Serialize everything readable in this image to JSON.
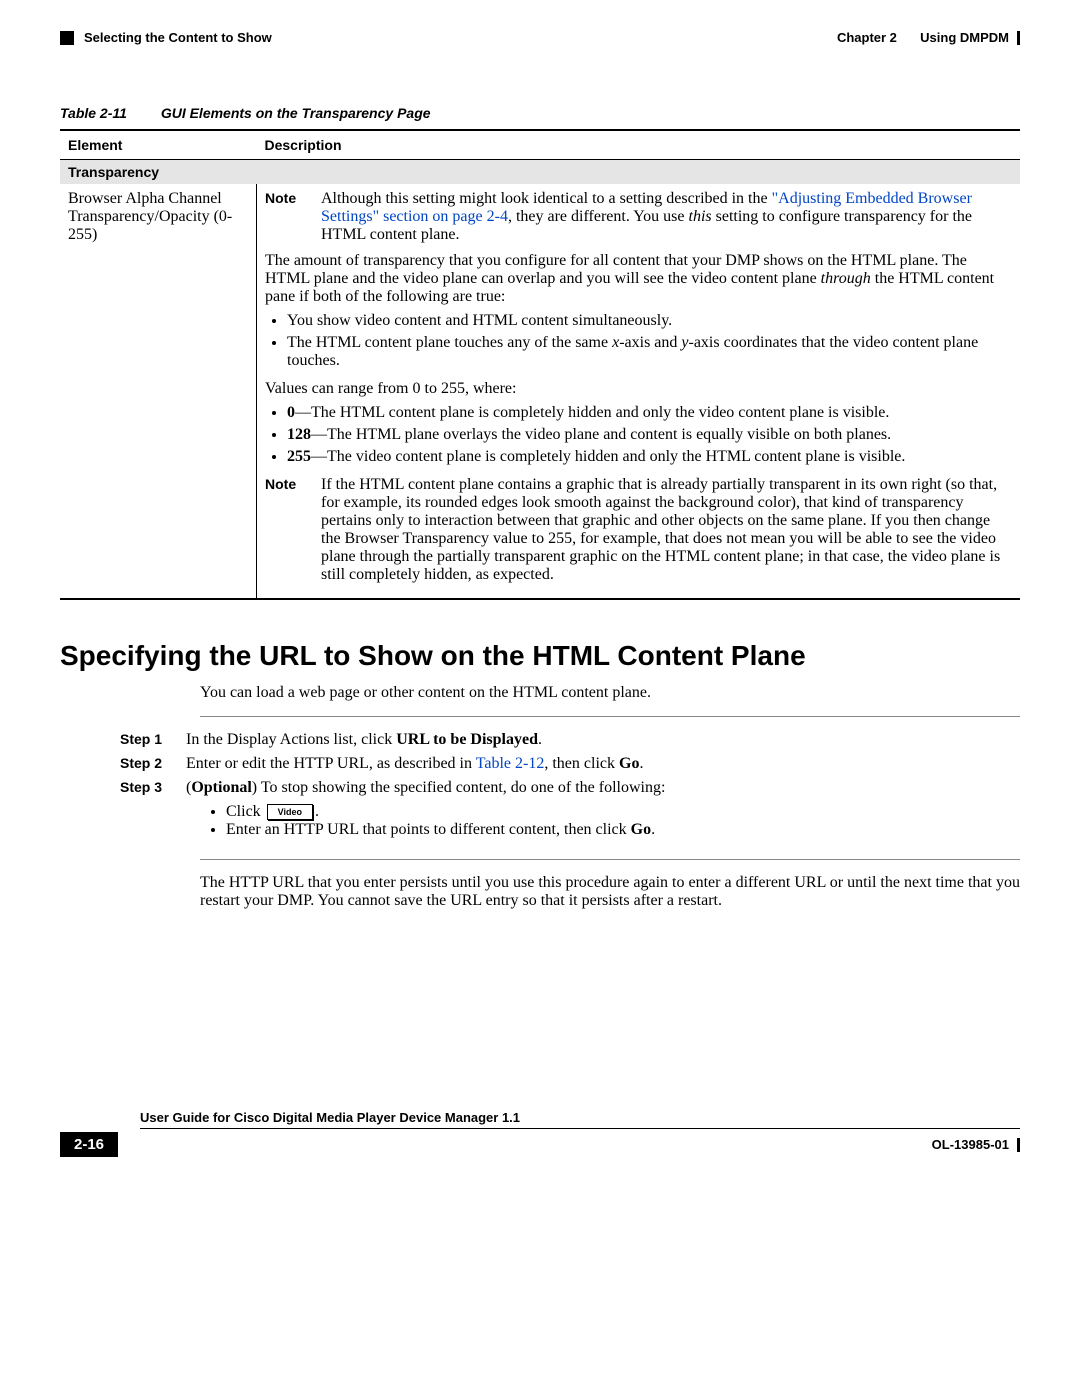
{
  "header": {
    "section_title": "Selecting the Content to Show",
    "chapter_label": "Chapter 2",
    "chapter_title": "Using DMPDM"
  },
  "table": {
    "number": "Table 2-11",
    "title": "GUI Elements on the Transparency Page",
    "col_element": "Element",
    "col_description": "Description",
    "section": "Transparency",
    "element_name": "Browser Alpha Channel Transparency/Opacity (0-255)",
    "note1_label": "Note",
    "note1_pre": "Although this setting might look identical to a setting described in the ",
    "note1_link": "\"Adjusting Embedded Browser Settings\" section on page 2-4",
    "note1_post1": ", they are different. You use ",
    "note1_this": "this",
    "note1_post2": " setting to configure transparency for the HTML content plane.",
    "para1_pre": "The amount of transparency that you configure for all content that your DMP shows on the HTML plane. The HTML plane and the video plane can overlap and you will see the video content plane ",
    "para1_through": "through",
    "para1_post": " the HTML content pane if both of the following are true:",
    "bullet1": "You show video content and HTML content simultaneously.",
    "bullet2_pre": "The HTML content plane touches any of the same ",
    "bullet2_x": "x",
    "bullet2_mid": "-axis and ",
    "bullet2_y": "y",
    "bullet2_post": "-axis coordinates that the video content plane touches.",
    "values_intro": "Values can range from 0 to 255, where:",
    "v0_key": "0",
    "v0_text": "—The HTML content plane is completely hidden and only the video content plane is visible.",
    "v128_key": "128",
    "v128_text": "—The HTML plane overlays the video plane and content is equally visible on both planes.",
    "v255_key": "255",
    "v255_text": "—The video content plane is completely hidden and only the HTML content plane is visible.",
    "note2_label": "Note",
    "note2_text": "If the HTML content plane contains a graphic that is already partially transparent in its own right (so that, for example, its rounded edges look smooth against the background color), that kind of transparency pertains only to interaction between that graphic and other objects on the same plane. If you then change the Browser Transparency value to 255, for example, that does not mean you will be able to see the video plane through the partially transparent graphic on the HTML content plane; in that case, the video plane is still completely hidden, as expected."
  },
  "section": {
    "heading": "Specifying the URL to Show on the HTML Content Plane",
    "intro": "You can load a web page or other content on the HTML content plane.",
    "step1_label": "Step 1",
    "step1_pre": "In the Display Actions list, click ",
    "step1_bold": "URL to be Displayed",
    "step2_label": "Step 2",
    "step2_pre": "Enter or edit the HTTP URL, as described in ",
    "step2_link": "Table 2-12",
    "step2_mid": ", then click ",
    "step2_bold": "Go",
    "step3_label": "Step 3",
    "step3_pre_bold": "Optional",
    "step3_pre_text": ") To stop showing the specified content, do one of the following:",
    "step3_sub1_pre": "Click ",
    "step3_sub1_btn": "Video",
    "step3_sub2_pre": "Enter an HTTP URL that points to different content, then click ",
    "step3_sub2_bold": "Go",
    "closing": "The HTTP URL that you enter persists until you use this procedure again to enter a different URL or until the next time that you restart your DMP. You cannot save the URL entry so that it persists after a restart."
  },
  "footer": {
    "guide_title": "User Guide for Cisco Digital Media Player Device Manager 1.1",
    "page_number": "2-16",
    "doc_id": "OL-13985-01"
  }
}
